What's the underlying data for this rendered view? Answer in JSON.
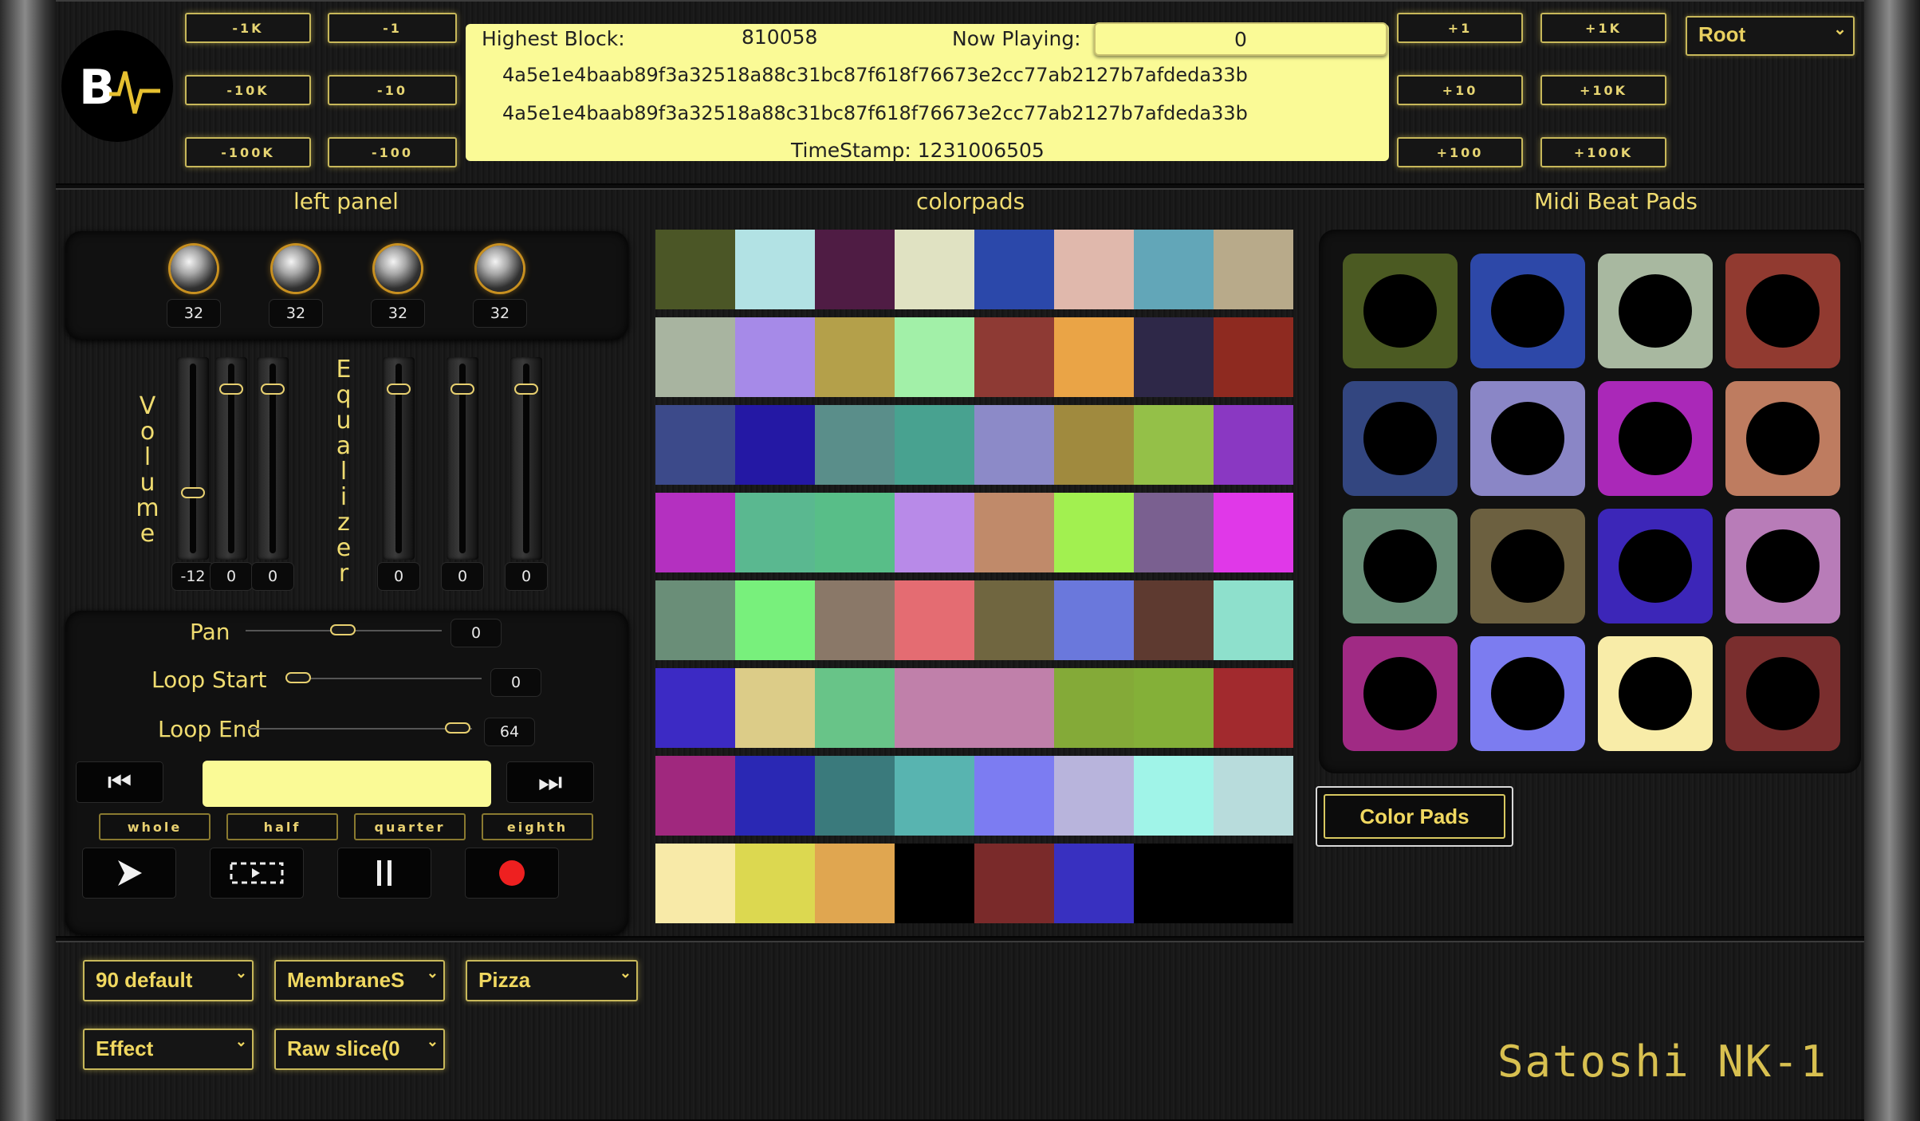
{
  "top": {
    "step_buttons": [
      "-1K",
      "-1",
      "-10K",
      "-10",
      "-100K",
      "-100",
      "+1",
      "+1K",
      "+10",
      "+10K",
      "+100",
      "+100K"
    ],
    "screen": {
      "highest_block_label": "Highest Block:",
      "highest_block_value": "810058",
      "now_playing_label": "Now Playing:",
      "now_playing_value": "0",
      "hash_1": "4a5e1e4baab89f3a32518a88c31bc87f618f76673e2cc77ab2127b7afdeda33b",
      "hash_2": "4a5e1e4baab89f3a32518a88c31bc87f618f76673e2cc77ab2127b7afdeda33b",
      "timestamp": "TimeStamp: 1231006505"
    },
    "root_select": "Root"
  },
  "sections": {
    "left": "left panel",
    "center": "colorpads",
    "right": "Midi Beat Pads"
  },
  "left_panel": {
    "knob_values": [
      "32",
      "32",
      "32",
      "32"
    ],
    "volume_label": "V\no\nl\nu\nm\ne",
    "equalizer_label": "E\nq\nu\na\nl\ni\nz\ne\nr",
    "slider_values": [
      "-12",
      "0",
      "0",
      "0",
      "0",
      "0"
    ],
    "slider_levels": [
      0.3,
      0.92,
      0.92,
      0.92,
      0.92,
      0.92
    ],
    "pan_label": "Pan",
    "pan_value": "0",
    "loop_start_label": "Loop Start",
    "loop_start_value": "0",
    "loop_end_label": "Loop End",
    "loop_end_value": "64",
    "prev_glyph": "⏮",
    "next_glyph": "⏭",
    "note_buttons": [
      "whole",
      "half",
      "quarter",
      "eighth"
    ]
  },
  "colorpads": [
    [
      "#4b5626",
      "#b2e2e4",
      "#4f1c44",
      "#e0e2c2",
      "#2b48aa",
      "#e0b8ac",
      "#62a6b8",
      "#b8aa8a"
    ],
    [
      "#a8b4a0",
      "#a68ae8",
      "#b4a04a",
      "#a2f0a8",
      "#8e3a34",
      "#eaa446",
      "#2e2848",
      "#8e2a20"
    ],
    [
      "#3c4a8a",
      "#2418a4",
      "#5a8e8a",
      "#48a290",
      "#8c8ac8",
      "#a08a3e",
      "#94c048",
      "#8a38c2"
    ],
    [
      "#b430c0",
      "#5ab890",
      "#58be88",
      "#b88ae8",
      "#c08a6a",
      "#a2f050",
      "#7a6090",
      "#e038e8"
    ],
    [
      "#6a8e78",
      "#78f07c",
      "#8a7868",
      "#e46c72",
      "#706640",
      "#6a78dc",
      "#5e3a30",
      "#8ee0cc"
    ],
    [
      "#3c2ac4",
      "#dccc88",
      "#68c488",
      "#c080aa",
      "#c080aa",
      "#84aa38",
      "#84b038",
      "#a22a2e"
    ],
    [
      "#a0287e",
      "#2a28b4",
      "#3a7a7c",
      "#58b4b0",
      "#7c7cf2",
      "#b8b4dc",
      "#a0f4e8",
      "#b8dcdc"
    ],
    [
      "#f8eaa8",
      "#dcd850",
      "#e0a650",
      "#000000",
      "#7a2a2a",
      "#3830c0",
      "#000000",
      "#000000"
    ]
  ],
  "midi_pads": [
    [
      "#4b5a22",
      "#2d48a8",
      "#a8b8a0",
      "#913a30"
    ],
    [
      "#334680",
      "#8a86c6",
      "#aa28b8",
      "#be7c60"
    ],
    [
      "#688e78",
      "#6c6040",
      "#3c26b8",
      "#b87cb8"
    ],
    [
      "#a02a84",
      "#7c7cf0",
      "#f8eca8",
      "#7a2e2e"
    ]
  ],
  "color_pads_button": "Color Pads",
  "bottom": {
    "selects": [
      "90 default",
      "MembraneS",
      "Pizza",
      "Effect",
      "Raw slice(0"
    ],
    "brand": "Satoshi NK-1"
  }
}
